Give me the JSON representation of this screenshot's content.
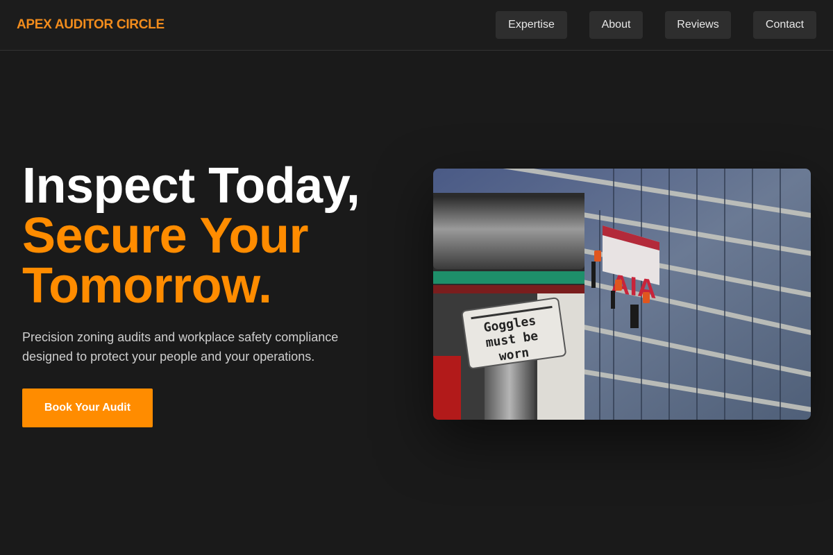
{
  "brand": {
    "name": "APEX AUDITOR CIRCLE"
  },
  "nav": {
    "items": [
      {
        "label": "Expertise"
      },
      {
        "label": "About"
      },
      {
        "label": "Reviews"
      },
      {
        "label": "Contact"
      }
    ]
  },
  "hero": {
    "title_line1": "Inspect Today,",
    "title_line2": "Secure Your",
    "title_line3": "Tomorrow.",
    "subtitle": "Precision zoning audits and workplace safety compliance designed to protect your people and your operations.",
    "cta_label": "Book Your Audit",
    "image": {
      "sign_line1": "Goggles",
      "sign_line2": "must be",
      "sign_line3": "worn",
      "building_logo": "AIA"
    }
  },
  "colors": {
    "accent": "#ff8c00",
    "background": "#1a1a1a",
    "nav_button": "#2e2e2e"
  }
}
